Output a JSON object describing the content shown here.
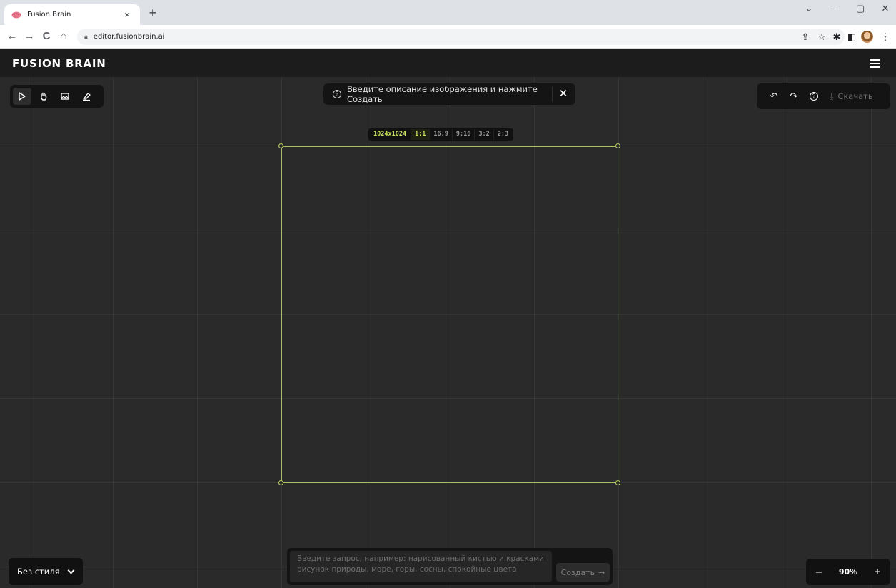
{
  "browser": {
    "tab_title": "Fusion Brain",
    "tab_close": "×",
    "new_tab": "+",
    "url": "editor.fusionbrain.ai",
    "nav_back": "←",
    "nav_forward": "→",
    "nav_reload": "C",
    "nav_home": "⌂",
    "win_dropdown": "⌄",
    "win_minimize": "–",
    "win_maximize": "▢",
    "win_close": "✕",
    "extension_icons": [
      "share-icon",
      "star-icon",
      "puzzle-icon",
      "sidepanel-icon"
    ]
  },
  "header": {
    "logo": "FUSION BRAIN",
    "menu_icon": "hamburger-icon"
  },
  "tools": {
    "items": [
      {
        "name": "select",
        "icon": "cursor-icon",
        "active": true
      },
      {
        "name": "hand",
        "icon": "hand-icon",
        "active": false
      },
      {
        "name": "image",
        "icon": "image-icon",
        "active": false
      },
      {
        "name": "eraser",
        "icon": "eraser-icon",
        "active": false
      }
    ]
  },
  "hint": {
    "icon": "?",
    "text": "Введите описание изображения и нажмите Создать",
    "close": "✕"
  },
  "right_panel": {
    "undo": "↶",
    "redo": "↷",
    "help": "?",
    "download_icon": "⤓",
    "download_label": "Скачать"
  },
  "ratios": {
    "size": "1024x1024",
    "options": [
      "1:1",
      "16:9",
      "9:16",
      "3:2",
      "2:3"
    ],
    "selected": "1:1"
  },
  "style": {
    "label": "Без стиля"
  },
  "prompt": {
    "placeholder_line1": "Введите запрос, например: нарисованный кистью и красками",
    "placeholder_line2": "рисунок природы, море, горы, сосны, спокойные цвета",
    "create_label": "Создать",
    "create_arrow": "→"
  },
  "zoom": {
    "minus": "–",
    "value": "90%",
    "plus": "+"
  },
  "colors": {
    "accent": "#c8e35e",
    "frame": "#a8c060",
    "canvas_bg": "#2a2a2a",
    "panel_bg": "#141414"
  }
}
